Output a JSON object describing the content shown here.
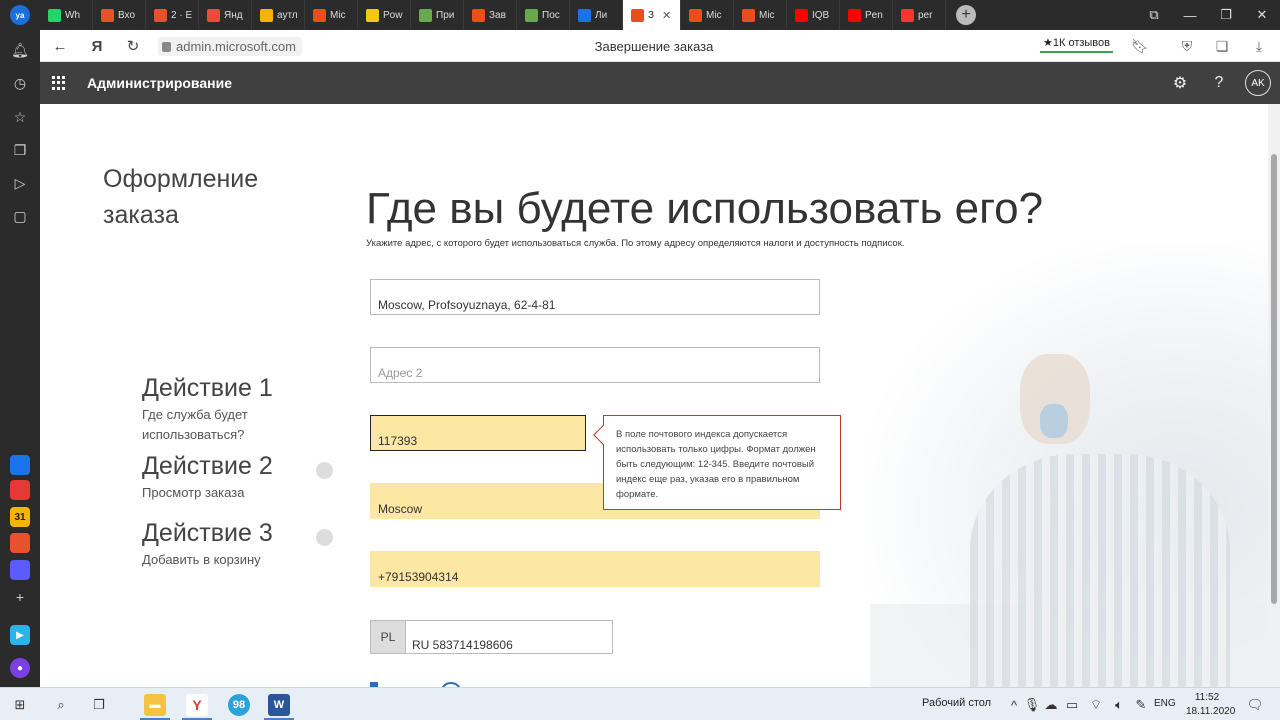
{
  "browser": {
    "tabs": [
      {
        "label": "Wh",
        "color": "#25d366"
      },
      {
        "label": "Вхо",
        "color": "#e6522c"
      },
      {
        "label": "2 · E",
        "color": "#e6522c"
      },
      {
        "label": "Янд",
        "color": "#e94b3c"
      },
      {
        "label": "аутл",
        "color": "#f5b400"
      },
      {
        "label": "Mic",
        "color": "#e84f1c"
      },
      {
        "label": "Pow",
        "color": "#f2c811"
      },
      {
        "label": "При",
        "color": "#6aa84f"
      },
      {
        "label": "Зав",
        "color": "#e84f1c"
      },
      {
        "label": "Пос",
        "color": "#6aa84f"
      },
      {
        "label": "Ли",
        "color": "#1a73e8"
      }
    ],
    "active_tab": {
      "label": "З",
      "close": "✕",
      "color": "#e84f1c"
    },
    "tabs_after": [
      {
        "label": "Mic",
        "color": "#e84f1c"
      },
      {
        "label": "Mic",
        "color": "#e84f1c"
      },
      {
        "label": "IQB",
        "color": "#ff0000"
      },
      {
        "label": "Pen",
        "color": "#ff0000"
      },
      {
        "label": "per",
        "color": "#ff3333"
      }
    ],
    "logo_text": "ya",
    "new_tab": "+",
    "url": "admin.microsoft.com",
    "page_title": "Завершение заказа",
    "reviews": "★1К отзывов",
    "ya_button": "Я"
  },
  "sidebar_apps": [
    {
      "label": "",
      "color": "#1a73e8"
    },
    {
      "label": "",
      "color": "#e53935"
    },
    {
      "label": "31",
      "color": "#f5b400"
    },
    {
      "label": "",
      "color": "#e6522c"
    },
    {
      "label": "",
      "color": "#5b5bff"
    }
  ],
  "header": {
    "brand": "Администрирование",
    "avatar": "AK"
  },
  "page": {
    "left_title": "Оформление заказа",
    "heading": "Где вы будете использовать его?",
    "subtitle": "Укажите адрес, с которого будет использоваться служба. По этому адресу определяются налоги и доступность подписок."
  },
  "form": {
    "address1": "Moscow, Profsoyuznaya, 62-4-81",
    "address2_placeholder": "Адрес 2",
    "postal": "117393",
    "city": "Moscow",
    "phone": "+79153904314",
    "country_code": "PL",
    "vat": "RU 583714198606"
  },
  "tooltip": {
    "text": "В поле почтового индекса допускается использовать только цифры. Формат должен быть следующим: 12-345. Введите почтовый индекс еще раз, указав его в правильном формате."
  },
  "steps": [
    {
      "name": "Действие 1",
      "desc": "Где служба будет использоваться?"
    },
    {
      "name": "Действие 2",
      "desc": "Просмотр заказа"
    },
    {
      "name": "Действие 3",
      "desc": "Добавить в корзину"
    }
  ],
  "taskbar": {
    "desktop_label": "Рабочий стол",
    "lang": "ENG",
    "time": "11:52",
    "date": "18.11.2020",
    "telegram_badge": "98"
  },
  "colors": {
    "accent": "#2a6ebb",
    "filled_field": "#fce8a2",
    "error_border": "#c0392b",
    "header_bg": "#404040"
  }
}
